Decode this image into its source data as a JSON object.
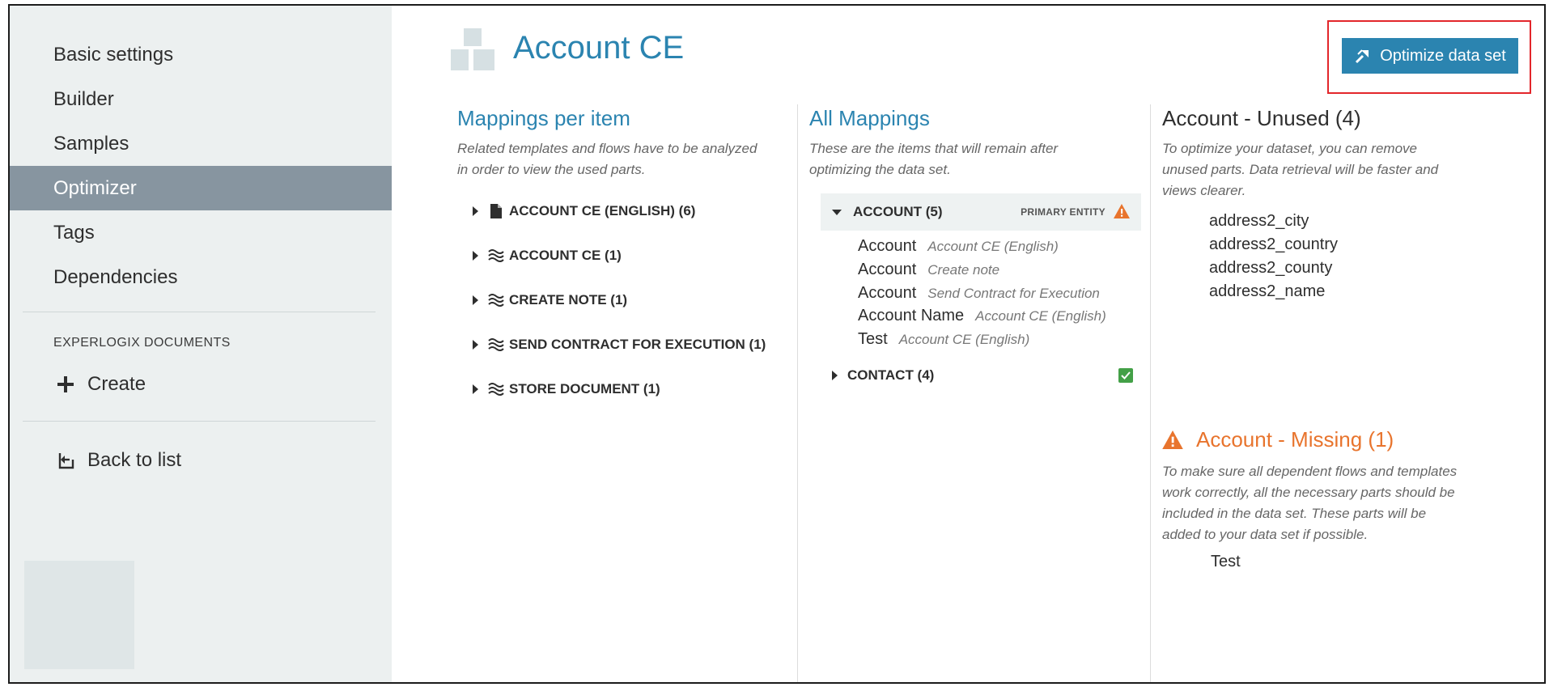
{
  "sidebar": {
    "nav": [
      {
        "label": "Basic settings",
        "active": false
      },
      {
        "label": "Builder",
        "active": false
      },
      {
        "label": "Samples",
        "active": false
      },
      {
        "label": "Optimizer",
        "active": true
      },
      {
        "label": "Tags",
        "active": false
      },
      {
        "label": "Dependencies",
        "active": false
      }
    ],
    "section_heading": "EXPERLOGIX DOCUMENTS",
    "create_label": "Create",
    "back_label": "Back to list"
  },
  "header": {
    "title": "Account CE",
    "optimize_button": "Optimize data set"
  },
  "mappings_per_item": {
    "title": "Mappings per item",
    "description_1": "Related templates and flows have to be analyzed",
    "description_2": "in order to view the used parts.",
    "items": [
      {
        "label": "ACCOUNT CE (ENGLISH) (6)",
        "icon": "document-icon"
      },
      {
        "label": "ACCOUNT CE (1)",
        "icon": "flow-icon"
      },
      {
        "label": "CREATE NOTE (1)",
        "icon": "flow-icon"
      },
      {
        "label": "SEND CONTRACT FOR EXECUTION (1)",
        "icon": "flow-icon"
      },
      {
        "label": "STORE DOCUMENT (1)",
        "icon": "flow-icon"
      }
    ]
  },
  "all_mappings": {
    "title": "All Mappings",
    "description_1": "These are the items that will remain after",
    "description_2": "optimizing the data set.",
    "account_group": {
      "label": "ACCOUNT (5)",
      "badge": "PRIMARY ENTITY",
      "rows": [
        {
          "field": "Account",
          "source": "Account CE (English)"
        },
        {
          "field": "Account",
          "source": "Create note"
        },
        {
          "field": "Account",
          "source": "Send Contract for Execution"
        },
        {
          "field": "Account Name",
          "source": "Account CE (English)"
        },
        {
          "field": "Test",
          "source": "Account CE (English)"
        }
      ]
    },
    "contact_group": {
      "label": "CONTACT (4)"
    }
  },
  "unused": {
    "title": "Account - Unused (4)",
    "description_1": "To optimize your dataset, you can remove",
    "description_2": "unused parts. Data retrieval will be faster and",
    "description_3": "views clearer.",
    "items": [
      "address2_city",
      "address2_country",
      "address2_county",
      "address2_name"
    ]
  },
  "missing": {
    "title": "Account - Missing (1)",
    "description_1": "To make sure all dependent flows and templates",
    "description_2": "work correctly, all the necessary parts should be",
    "description_3": "included in the data set. These parts will be",
    "description_4": "added to your data set if possible.",
    "items": [
      "Test"
    ]
  },
  "colors": {
    "accent": "#2b84b0",
    "warning": "#e8742d",
    "sidebar_bg": "#ecf0f0",
    "active_nav": "#8795a0",
    "success": "#43a047"
  }
}
